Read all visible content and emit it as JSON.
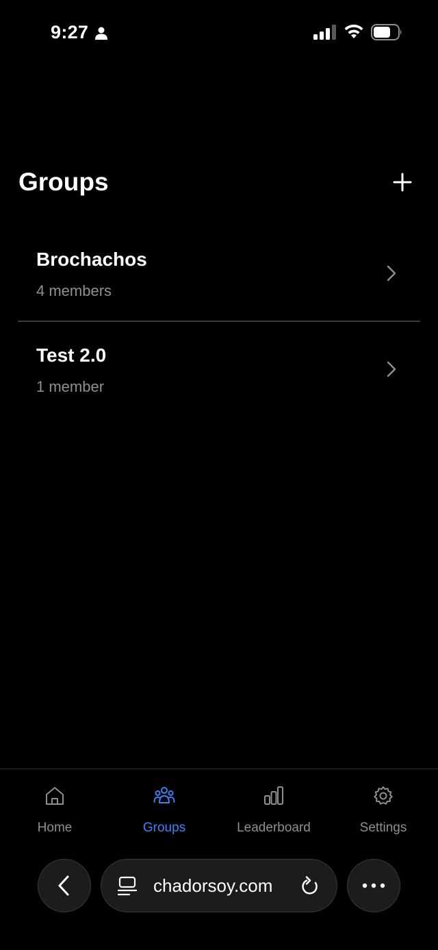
{
  "status_bar": {
    "time": "9:27"
  },
  "header": {
    "title": "Groups",
    "add_icon": "plus-icon"
  },
  "groups": [
    {
      "name": "Brochachos",
      "members": "4 members"
    },
    {
      "name": "Test 2.0",
      "members": "1 member"
    }
  ],
  "tab_bar": {
    "active": "Groups",
    "active_color": "#3b82f6",
    "inactive_color": "#8e8e93",
    "tabs": [
      {
        "label": "Home",
        "icon": "home-icon"
      },
      {
        "label": "Groups",
        "icon": "groups-icon"
      },
      {
        "label": "Leaderboard",
        "icon": "bar-chart-icon"
      },
      {
        "label": "Settings",
        "icon": "gear-icon"
      }
    ]
  },
  "browser": {
    "url": "chadorsoy.com",
    "icons": [
      "back-arrow-icon",
      "page-menu-icon",
      "reload-icon",
      "more-icon"
    ]
  }
}
